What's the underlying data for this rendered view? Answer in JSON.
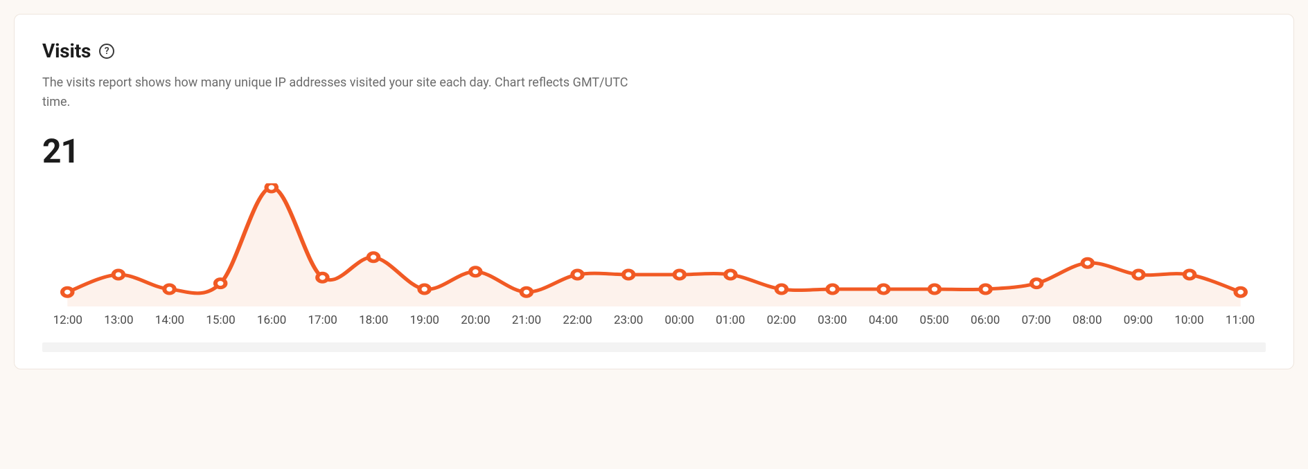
{
  "header": {
    "title": "Visits",
    "help_glyph": "?",
    "description": "The visits report shows how many unique IP addresses visited your site each day. Chart reflects GMT/UTC time."
  },
  "summary": {
    "total": "21"
  },
  "chart_data": {
    "type": "line",
    "title": "Visits",
    "xlabel": "",
    "ylabel": "",
    "ylim": [
      0,
      4
    ],
    "categories": [
      "12:00",
      "13:00",
      "14:00",
      "15:00",
      "16:00",
      "17:00",
      "18:00",
      "19:00",
      "20:00",
      "21:00",
      "22:00",
      "23:00",
      "00:00",
      "01:00",
      "02:00",
      "03:00",
      "04:00",
      "05:00",
      "06:00",
      "07:00",
      "08:00",
      "09:00",
      "10:00",
      "11:00"
    ],
    "series": [
      {
        "name": "Visits",
        "color": "#f15a24",
        "values": [
          0.4,
          1.0,
          0.5,
          0.7,
          4.0,
          0.9,
          1.6,
          0.5,
          1.1,
          0.4,
          1.0,
          1.0,
          1.0,
          1.0,
          0.5,
          0.5,
          0.5,
          0.5,
          0.5,
          0.7,
          1.4,
          1.0,
          1.0,
          0.4
        ]
      }
    ]
  }
}
